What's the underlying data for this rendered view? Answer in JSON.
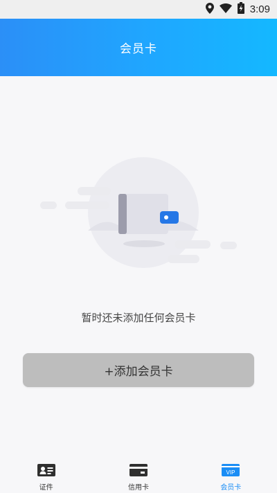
{
  "status_bar": {
    "time": "3:09",
    "icons": [
      "location-icon",
      "wifi-icon",
      "battery-charging-icon"
    ]
  },
  "header": {
    "title": "会员卡"
  },
  "empty_state": {
    "message": "暂时还未添加任何会员卡",
    "illustration": "empty-wallet-illustration"
  },
  "add_button": {
    "label": "+添加会员卡"
  },
  "tabs": [
    {
      "label": "证件",
      "icon": "id-card-icon",
      "active": false
    },
    {
      "label": "信用卡",
      "icon": "credit-card-icon",
      "active": false
    },
    {
      "label": "会员卡",
      "icon": "vip-card-icon",
      "active": true
    }
  ],
  "colors": {
    "header_start": "#2b8ff7",
    "header_end": "#14b8ff",
    "accent": "#1a8df5",
    "button_bg": "#bdbdbd"
  }
}
